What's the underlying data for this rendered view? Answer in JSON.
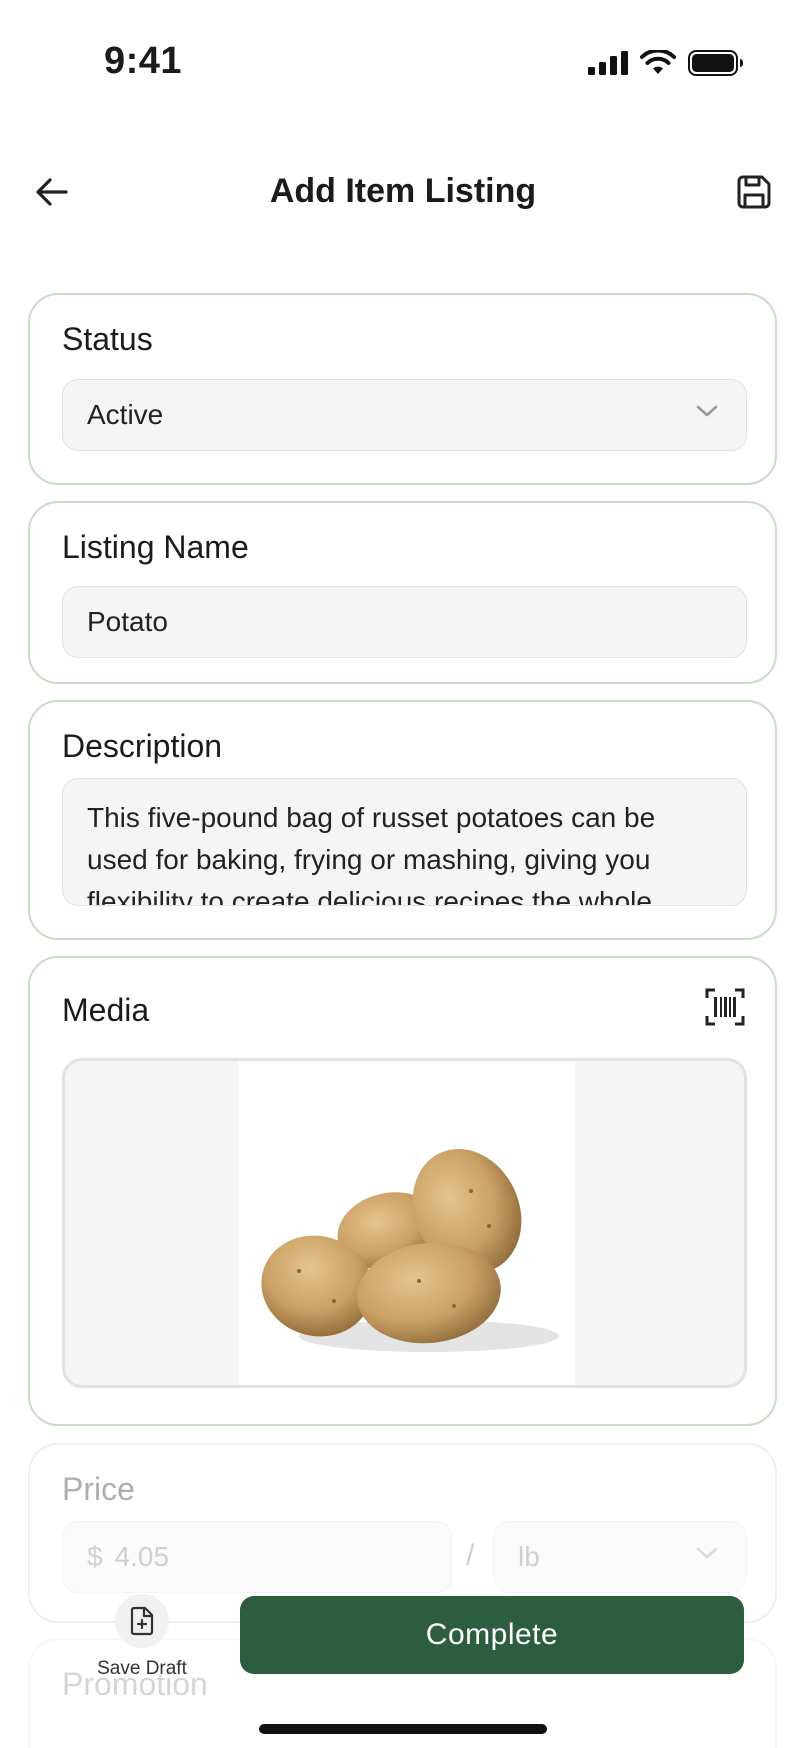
{
  "status_bar": {
    "time": "9:41"
  },
  "header": {
    "title": "Add Item Listing"
  },
  "status": {
    "label": "Status",
    "value": "Active"
  },
  "listing_name": {
    "label": "Listing Name",
    "value": "Potato"
  },
  "description": {
    "label": "Description",
    "value": "This five-pound bag of russet potatoes can be used for baking, frying or mashing, giving you flexibility to create delicious recipes the whole"
  },
  "media": {
    "label": "Media"
  },
  "price": {
    "label": "Price",
    "currency_symbol": "$",
    "value": "4.05",
    "separator": "/",
    "unit": "lb"
  },
  "promotion": {
    "label": "Promotion"
  },
  "actions": {
    "save_draft": "Save Draft",
    "complete": "Complete"
  },
  "colors": {
    "accent": "#2c5d3f",
    "card_border": "#c9dcc5"
  }
}
